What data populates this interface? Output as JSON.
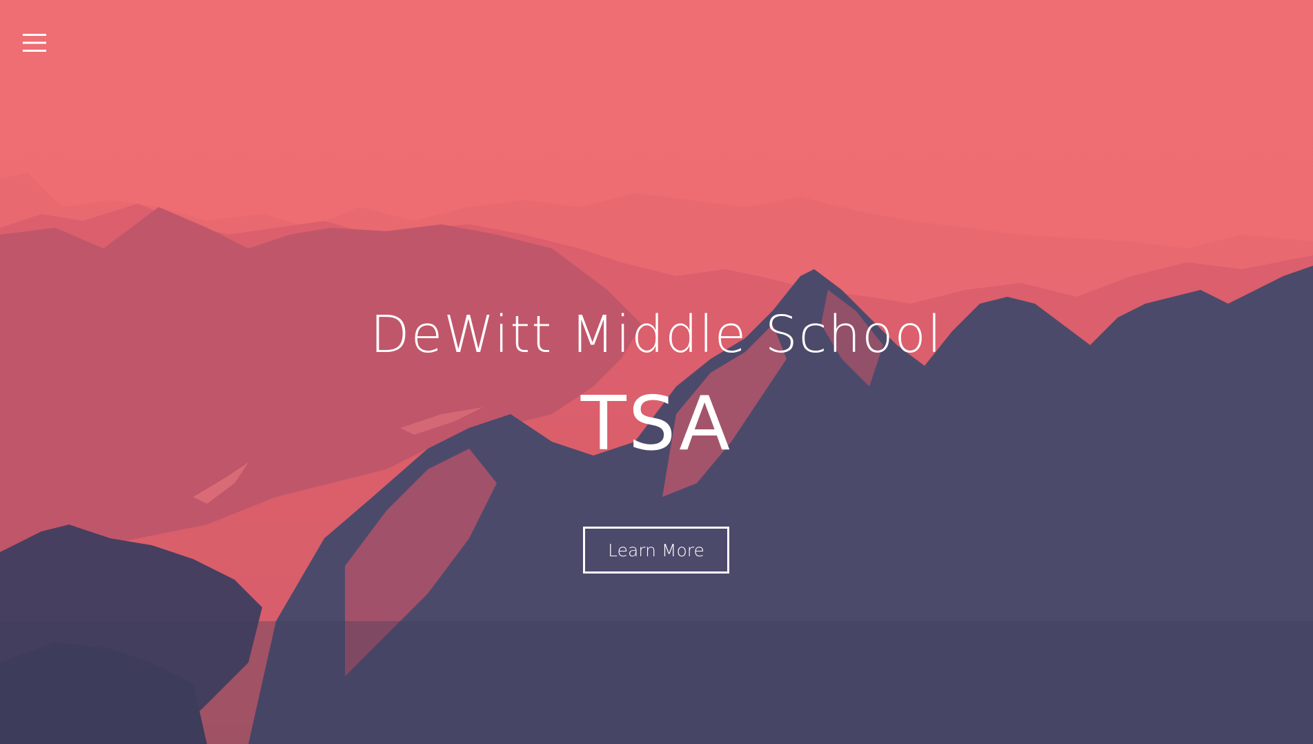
{
  "hero": {
    "school_name": "DeWitt Middle School",
    "org_name": "TSA",
    "cta_label": "Learn More"
  },
  "menu": {
    "icon": "hamburger-menu-icon"
  },
  "colors": {
    "overlay_pink": "#ed6d73",
    "mountain_dark": "#47496a",
    "mountain_mid": "#a85468",
    "text": "#ffffff"
  }
}
